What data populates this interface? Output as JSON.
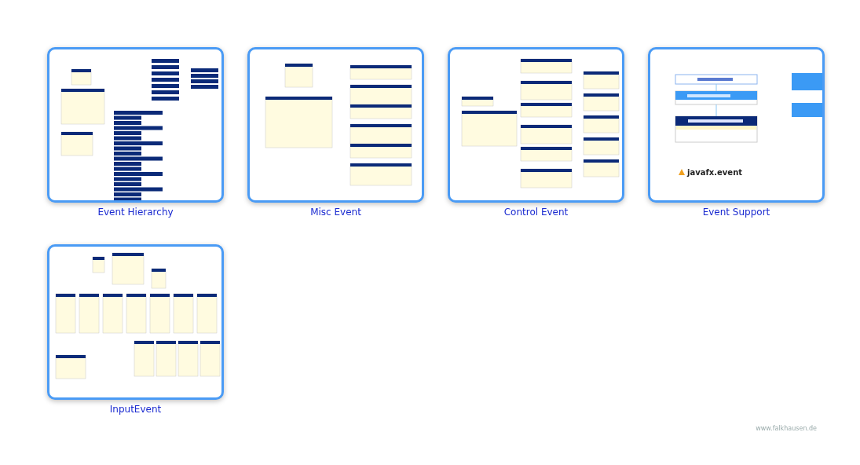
{
  "gallery": [
    {
      "title": "Event Hierarchy",
      "preview": {
        "kind": "hierarchy"
      }
    },
    {
      "title": "Misc Event",
      "preview": {
        "kind": "misc"
      }
    },
    {
      "title": "Control Event",
      "preview": {
        "kind": "control"
      }
    },
    {
      "title": "Event Support",
      "preview": {
        "kind": "support",
        "labels": [
          "javafx.event"
        ]
      }
    },
    {
      "title": "InputEvent",
      "preview": {
        "kind": "input"
      }
    }
  ],
  "footer": {
    "site": "www.falkhausen.de"
  }
}
